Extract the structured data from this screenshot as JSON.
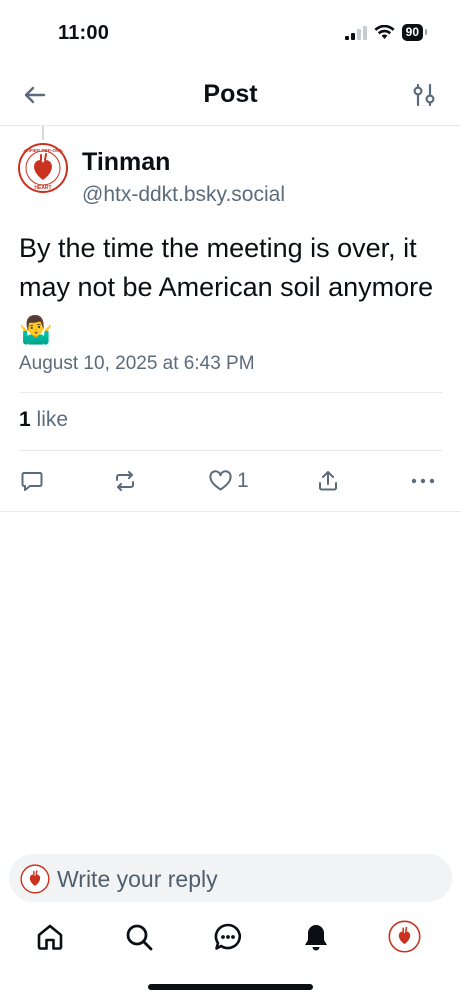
{
  "status_bar": {
    "time": "11:00",
    "battery": "90"
  },
  "header": {
    "title": "Post"
  },
  "post": {
    "author": {
      "display_name": "Tinman",
      "handle": "@htx-ddkt.bsky.social"
    },
    "text": "By the time the meeting is over, it may not be American soil anymore",
    "emoji": "🤷‍♂️",
    "date": "August 10, 2025 at 6:43 PM",
    "like_count": "1",
    "like_label": "like",
    "actions": {
      "like_count": "1"
    }
  },
  "reply": {
    "placeholder": "Write your reply"
  },
  "avatar": {
    "top_text": "CERTIFIED PRE-OWNED",
    "bottom_text": "HEART"
  },
  "colors": {
    "icon": "#5b6b7b",
    "text": "#0b0f14",
    "muted": "#5b6b7b",
    "avatar_red": "#c9321f",
    "avatar_ring": "#d9a441"
  },
  "icons": {
    "back": "arrow-left-icon",
    "filter": "sliders-icon",
    "reply": "speech-bubble-icon",
    "repost": "repost-icon",
    "like": "heart-icon",
    "share": "share-icon",
    "more": "ellipsis-icon",
    "home": "home-icon",
    "search": "search-icon",
    "chat": "chat-icon",
    "notifications": "bell-icon"
  }
}
